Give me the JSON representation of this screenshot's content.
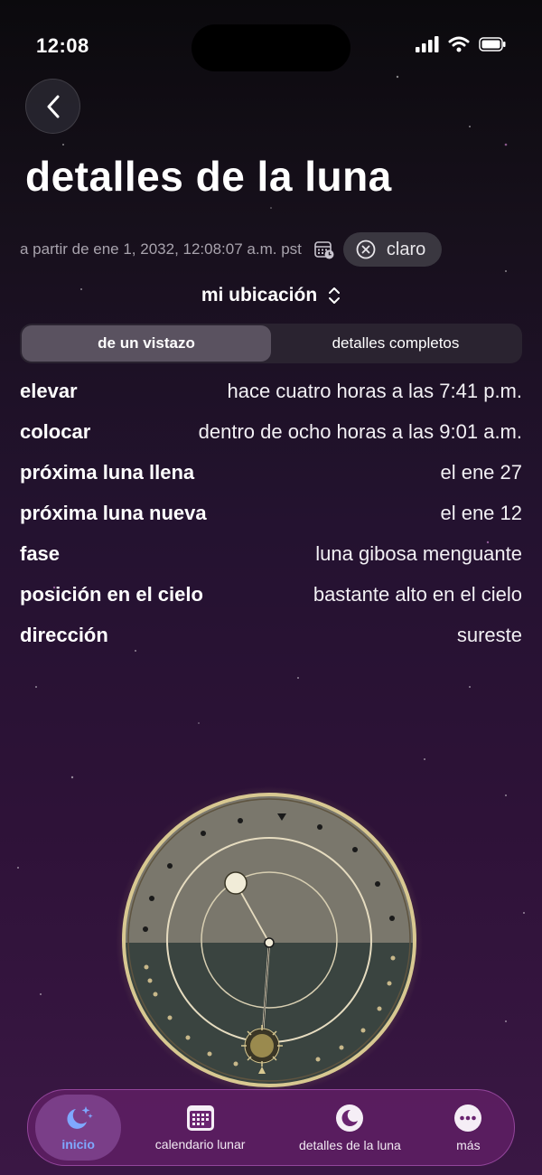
{
  "status_bar": {
    "time": "12:08"
  },
  "header": {
    "title": "detalles de la luna"
  },
  "date_row": {
    "text": "a partir de ene 1, 2032, 12:08:07 a.m. pst",
    "clear_label": "claro"
  },
  "location": {
    "label": "mi ubicación"
  },
  "segments": [
    {
      "label": "de un vistazo",
      "selected": true
    },
    {
      "label": "detalles completos",
      "selected": false
    }
  ],
  "info": [
    {
      "label": "elevar",
      "value": "hace cuatro horas a las 7:41 p.m."
    },
    {
      "label": "colocar",
      "value": "dentro de ocho horas a las 9:01 a.m."
    },
    {
      "label": "próxima luna llena",
      "value": "el ene 27"
    },
    {
      "label": "próxima luna nueva",
      "value": "el ene 12"
    },
    {
      "label": "fase",
      "value": "luna gibosa menguante"
    },
    {
      "label": "posición en el cielo",
      "value": "bastante alto en el cielo"
    },
    {
      "label": "dirección",
      "value": "sureste"
    }
  ],
  "tabs": [
    {
      "label": "inicio",
      "icon": "moon-stars-icon",
      "active": true
    },
    {
      "label": "calendario lunar",
      "icon": "calendar-grid-icon",
      "active": false
    },
    {
      "label": "detalles de la luna",
      "icon": "crescent-moon-icon",
      "active": false
    },
    {
      "label": "más",
      "icon": "more-dots-icon",
      "active": false
    }
  ],
  "colors": {
    "accent": "#7fa8ff",
    "tab_bar": "#5f1e64",
    "dial_day": "#7a776c",
    "dial_night": "#3a4440",
    "gold": "#b8a36a"
  }
}
